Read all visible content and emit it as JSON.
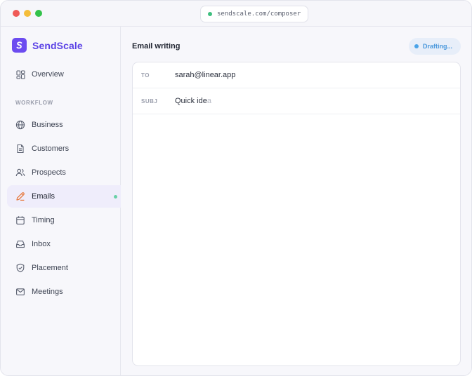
{
  "window": {
    "url": "sendscale.com/composer"
  },
  "brand": {
    "name": "SendScale"
  },
  "sidebar": {
    "overview_label": "Overview",
    "section_label": "WORKFLOW",
    "items": [
      {
        "label": "Business",
        "icon": "globe-icon"
      },
      {
        "label": "Customers",
        "icon": "document-icon"
      },
      {
        "label": "Prospects",
        "icon": "users-icon"
      },
      {
        "label": "Emails",
        "icon": "pen-icon",
        "active": true
      },
      {
        "label": "Timing",
        "icon": "calendar-icon"
      },
      {
        "label": "Inbox",
        "icon": "inbox-icon"
      },
      {
        "label": "Placement",
        "icon": "shield-icon"
      },
      {
        "label": "Meetings",
        "icon": "mail-icon"
      }
    ]
  },
  "main": {
    "title": "Email writing",
    "status": "Drafting..."
  },
  "composer": {
    "to_key": "TO",
    "to_value": "sarah@linear.app",
    "subject_key": "SUBJ",
    "subject_typed": "Quick ide",
    "subject_pending": "a"
  },
  "colors": {
    "brand": "#5b42e6",
    "active_bg": "#efedfb",
    "active_indicator": "#69d1a7",
    "status": "#4a98dc"
  }
}
